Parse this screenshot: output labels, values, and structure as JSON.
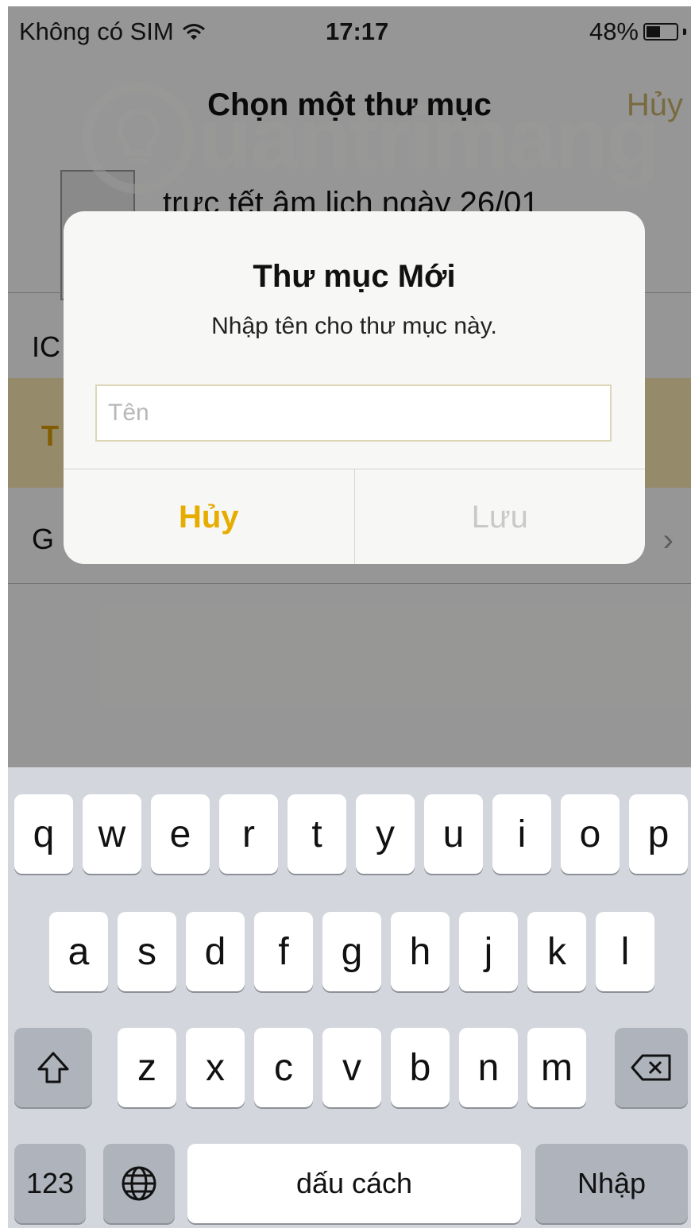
{
  "status_bar": {
    "carrier": "Không có SIM",
    "time": "17:17",
    "battery_percent": "48%",
    "battery_level": 0.48
  },
  "background": {
    "nav_title": "Chọn một thư mục",
    "nav_cancel": "Hủy",
    "note_title": "trực tết âm lịch ngày 26/01",
    "rows": [
      "IC",
      "T",
      "G"
    ]
  },
  "watermark": {
    "text": "uantrimang"
  },
  "alert": {
    "title": "Thư mục Mới",
    "message": "Nhập tên cho thư mục này.",
    "input_placeholder": "Tên",
    "input_value": "",
    "cancel_label": "Hủy",
    "save_label": "Lưu"
  },
  "keyboard": {
    "row1": [
      "q",
      "w",
      "e",
      "r",
      "t",
      "y",
      "u",
      "i",
      "o",
      "p"
    ],
    "row2": [
      "a",
      "s",
      "d",
      "f",
      "g",
      "h",
      "j",
      "k",
      "l"
    ],
    "row3": [
      "z",
      "x",
      "c",
      "v",
      "b",
      "n",
      "m"
    ],
    "numbers_label": "123",
    "space_label": "dấu cách",
    "return_label": "Nhập"
  },
  "colors": {
    "accent": "#e6ac00",
    "keyboard_bg": "#d3d6dc"
  }
}
